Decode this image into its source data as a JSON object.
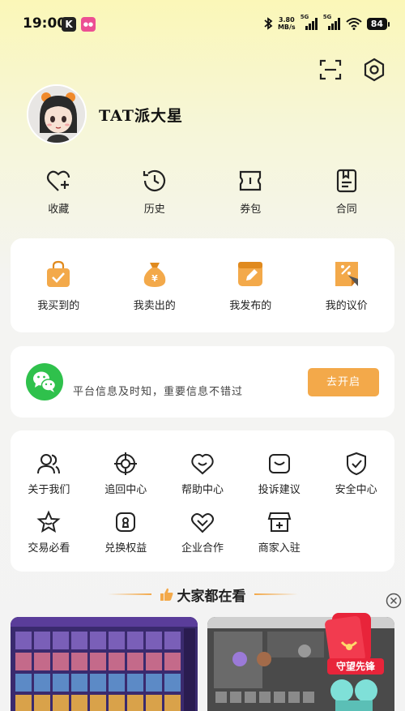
{
  "status_bar": {
    "time": "19:00",
    "net_speed_value": "3.80",
    "net_speed_unit": "MB/s",
    "sim1": "5G",
    "sim2": "5G",
    "battery": "84"
  },
  "profile": {
    "username": "TAT派大星"
  },
  "quick_actions": [
    {
      "label": "收藏",
      "icon": "heart-plus-icon"
    },
    {
      "label": "历史",
      "icon": "history-clock-icon"
    },
    {
      "label": "券包",
      "icon": "coupon-icon"
    },
    {
      "label": "合同",
      "icon": "contract-icon"
    }
  ],
  "orders": [
    {
      "label": "我买到的",
      "icon": "shopping-bag-icon"
    },
    {
      "label": "我卖出的",
      "icon": "money-bag-icon"
    },
    {
      "label": "我发布的",
      "icon": "edit-note-icon"
    },
    {
      "label": "我的议价",
      "icon": "price-tag-icon"
    }
  ],
  "notify": {
    "text": "平台信息及时知，重要信息不错过",
    "button": "去开启"
  },
  "services": [
    {
      "label": "关于我们",
      "icon": "users-icon"
    },
    {
      "label": "追回中心",
      "icon": "target-icon"
    },
    {
      "label": "帮助中心",
      "icon": "help-smile-icon"
    },
    {
      "label": "投诉建议",
      "icon": "feedback-icon"
    },
    {
      "label": "安全中心",
      "icon": "shield-check-icon"
    },
    {
      "label": "交易必看",
      "icon": "star-icon"
    },
    {
      "label": "兑换权益",
      "icon": "lock-badge-icon"
    },
    {
      "label": "企业合作",
      "icon": "handshake-icon"
    },
    {
      "label": "商家入驻",
      "icon": "store-add-icon"
    }
  ],
  "section": {
    "title": "大家都在看"
  },
  "promo": {
    "label": "守望先锋"
  },
  "colors": {
    "accent": "#f3a94a",
    "wechat_green": "#2fc14c"
  }
}
